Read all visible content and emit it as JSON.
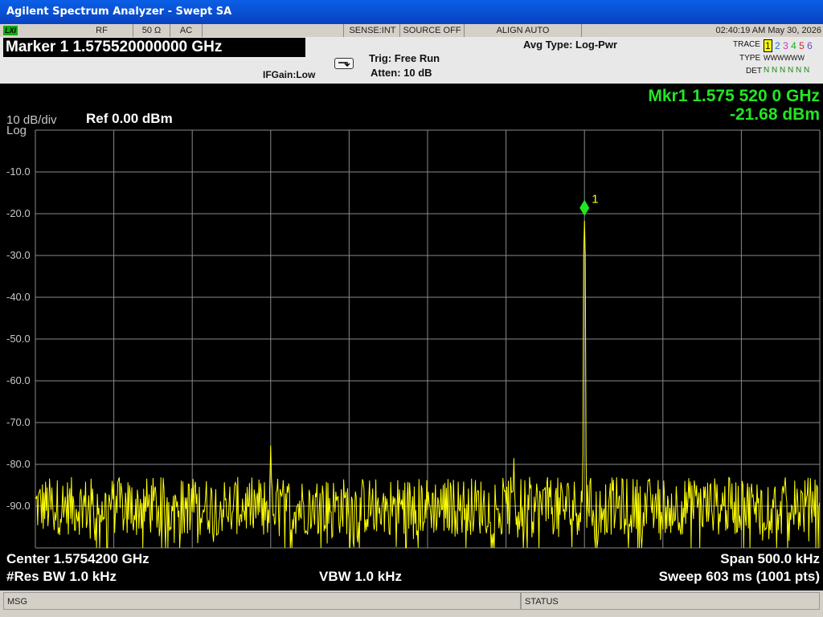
{
  "window": {
    "title": "Agilent Spectrum Analyzer - Swept SA"
  },
  "statusbar": {
    "lxi": "LXI",
    "rf": "RF",
    "impedance": "50 Ω",
    "coupling": "AC",
    "sense": "SENSE:INT",
    "source": "SOURCE OFF",
    "align": "ALIGN AUTO",
    "datetime": "02:40:19 AM May 30, 2026"
  },
  "header": {
    "marker": "Marker 1 1.575520000000 GHz",
    "avg_type": "Avg Type: Log-Pwr",
    "trig": "Trig: Free Run",
    "atten": "Atten: 10 dB",
    "ifgain": "IFGain:Low",
    "trace_label": "TRACE",
    "trace_nums": [
      "1",
      "2",
      "3",
      "4",
      "5",
      "6"
    ],
    "type_label": "TYPE",
    "type_val": "WWWWWW",
    "det_label": "DET",
    "det_val": "N N N N N N"
  },
  "display": {
    "scale": "10 dB/div",
    "scale_type": "Log",
    "ref": "Ref 0.00 dBm",
    "mkr_freq": "Mkr1 1.575 520 0 GHz",
    "mkr_amp": "-21.68 dBm",
    "marker_num": "1",
    "yticks": [
      "-10.0",
      "-20.0",
      "-30.0",
      "-40.0",
      "-50.0",
      "-60.0",
      "-70.0",
      "-80.0",
      "-90.0"
    ],
    "center": "Center 1.5754200 GHz",
    "span": "Span 500.0 kHz",
    "rbw": "#Res BW 1.0 kHz",
    "vbw": "VBW 1.0 kHz",
    "sweep": "Sweep  603 ms (1001 pts)"
  },
  "bottom": {
    "msg": "MSG",
    "status": "STATUS"
  },
  "chart_data": {
    "type": "line",
    "ylim": [
      -100,
      0
    ],
    "xlim_ghz": [
      1.57517,
      1.57567
    ],
    "grid": true,
    "trace_color": "#ffff00",
    "noise_floor_dbm": -90,
    "peaks": [
      {
        "freq_ghz": 1.57552,
        "amp_dbm": -21.68
      },
      {
        "freq_ghz": 1.57532,
        "amp_dbm": -75.5
      },
      {
        "freq_ghz": 1.575475,
        "amp_dbm": -78.5
      }
    ]
  }
}
